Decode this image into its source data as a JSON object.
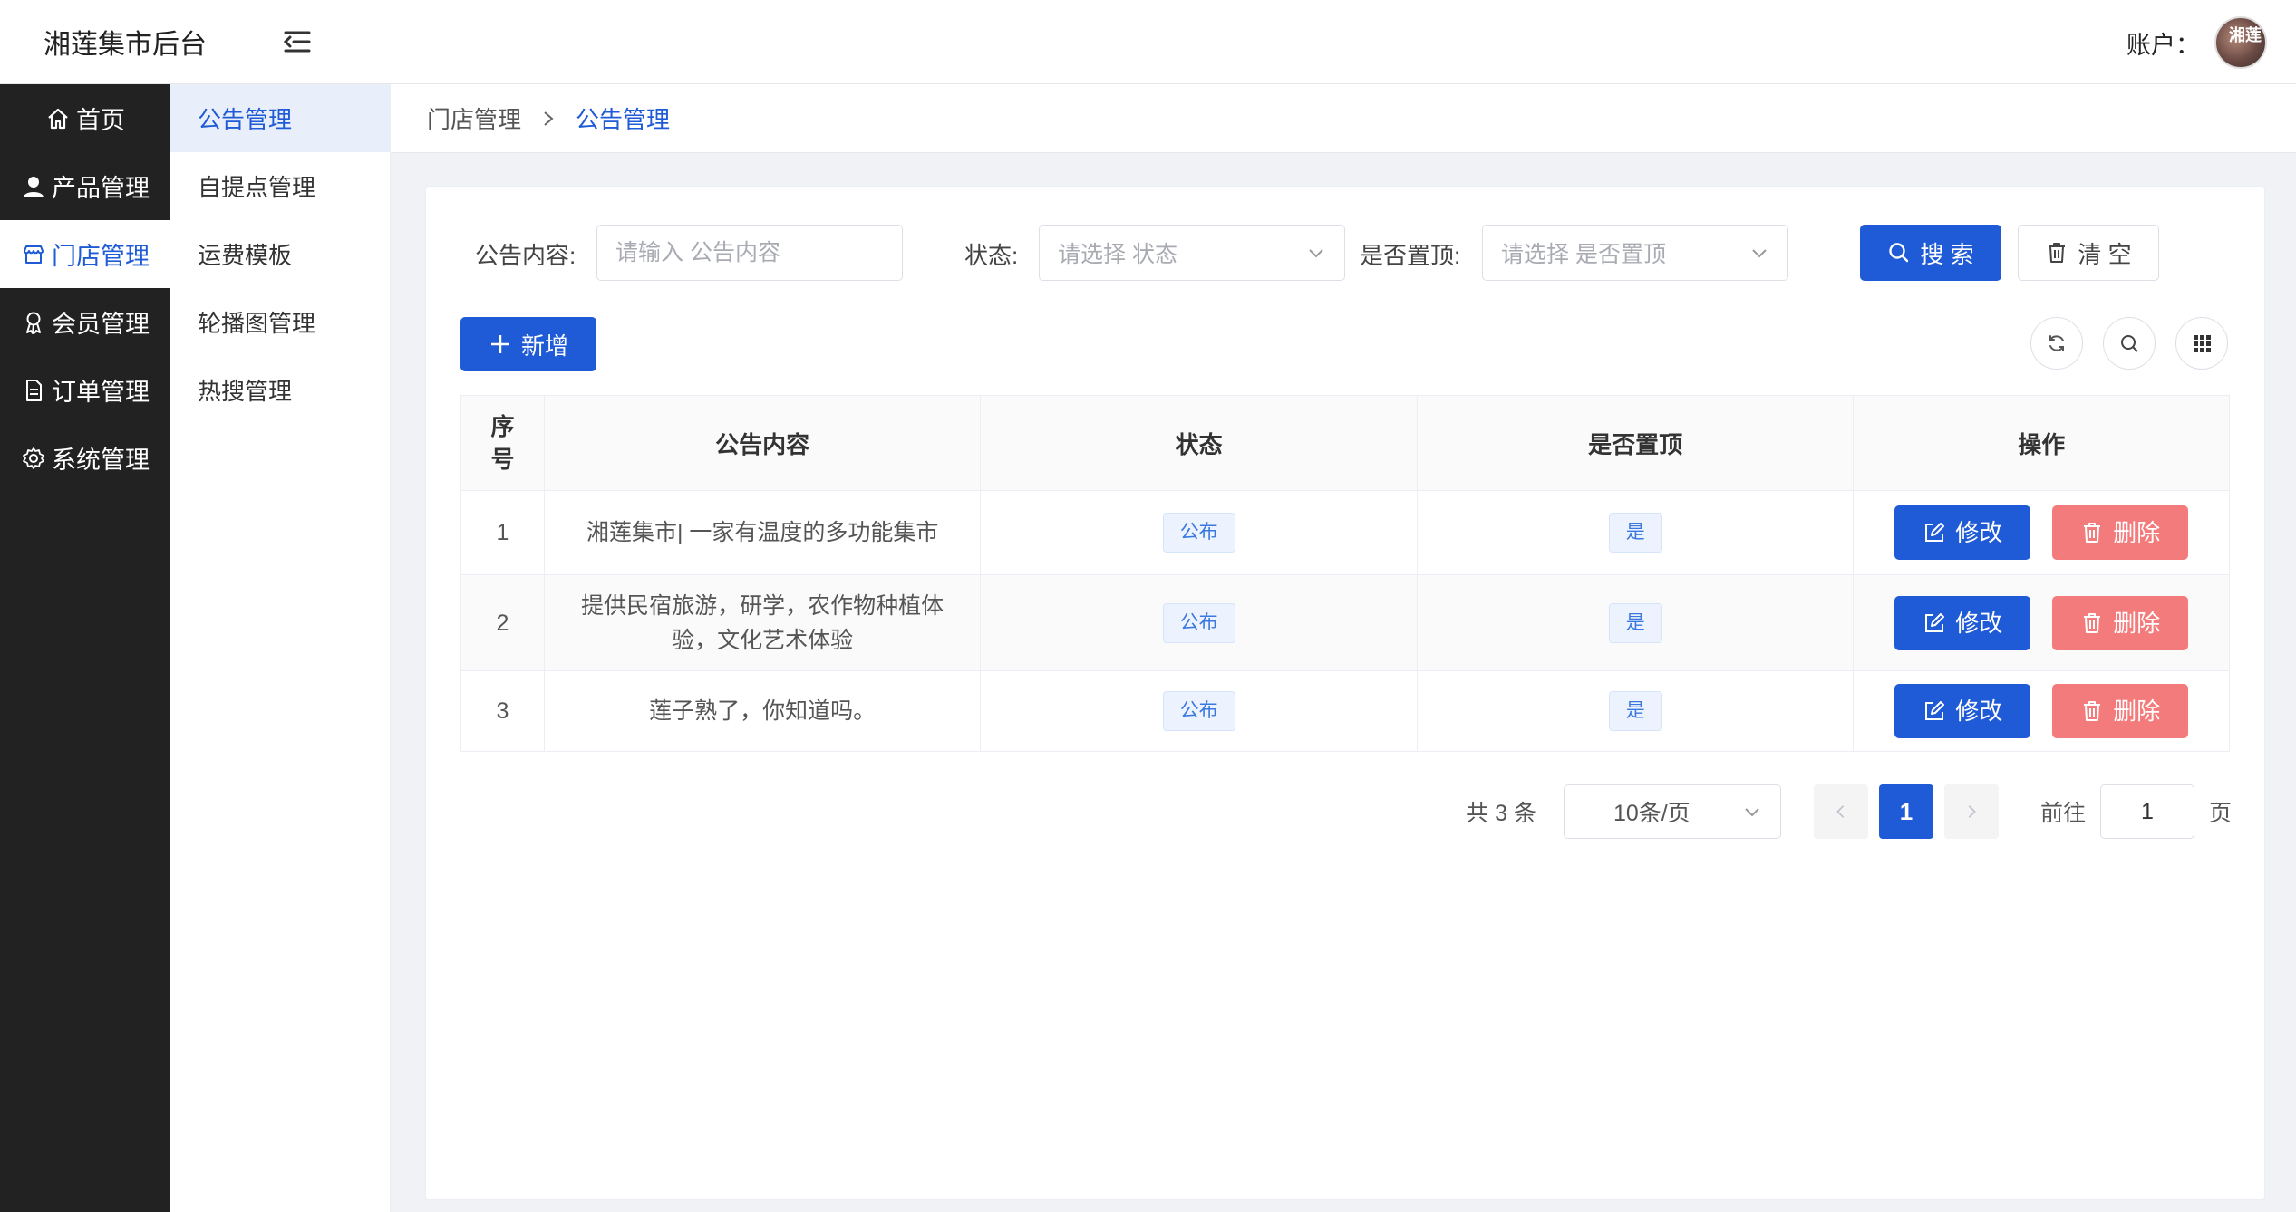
{
  "header": {
    "title": "湘莲集市后台",
    "account_label": "账户：",
    "avatar_text": "湘莲"
  },
  "menu": {
    "items": [
      {
        "label": "首页",
        "icon": "home-icon"
      },
      {
        "label": "产品管理",
        "icon": "user-icon"
      },
      {
        "label": "门店管理",
        "icon": "store-icon",
        "active": true
      },
      {
        "label": "会员管理",
        "icon": "medal-icon"
      },
      {
        "label": "订单管理",
        "icon": "document-icon"
      },
      {
        "label": "系统管理",
        "icon": "gear-icon"
      }
    ]
  },
  "submenu": {
    "items": [
      {
        "label": "公告管理",
        "active": true
      },
      {
        "label": "自提点管理"
      },
      {
        "label": "运费模板"
      },
      {
        "label": "轮播图管理"
      },
      {
        "label": "热搜管理"
      }
    ]
  },
  "breadcrumb": {
    "parent": "门店管理",
    "current": "公告管理"
  },
  "search": {
    "content_label": "公告内容:",
    "content_placeholder": "请输入 公告内容",
    "status_label": "状态:",
    "status_placeholder": "请选择 状态",
    "top_label": "是否置顶:",
    "top_placeholder": "请选择 是否置顶",
    "search_button": "搜 索",
    "clear_button": "清 空"
  },
  "toolbar": {
    "add_button": "新增"
  },
  "table": {
    "columns": [
      "序号",
      "公告内容",
      "状态",
      "是否置顶",
      "操作"
    ],
    "rows": [
      {
        "index": "1",
        "content": "湘莲集市| 一家有温度的多功能集市",
        "status": "公布",
        "top": "是"
      },
      {
        "index": "2",
        "content": "提供民宿旅游，研学，农作物种植体验，文化艺术体验",
        "status": "公布",
        "top": "是"
      },
      {
        "index": "3",
        "content": "莲子熟了，你知道吗。",
        "status": "公布",
        "top": "是"
      }
    ],
    "edit_label": "修改",
    "delete_label": "删除"
  },
  "pagination": {
    "total": "共 3 条",
    "page_size": "10条/页",
    "current_page": "1",
    "goto_label": "前往",
    "goto_value": "1",
    "page_suffix": "页"
  },
  "colors": {
    "primary": "#1f5bd6",
    "danger": "#f47b7b",
    "menu_bg": "#222222"
  }
}
